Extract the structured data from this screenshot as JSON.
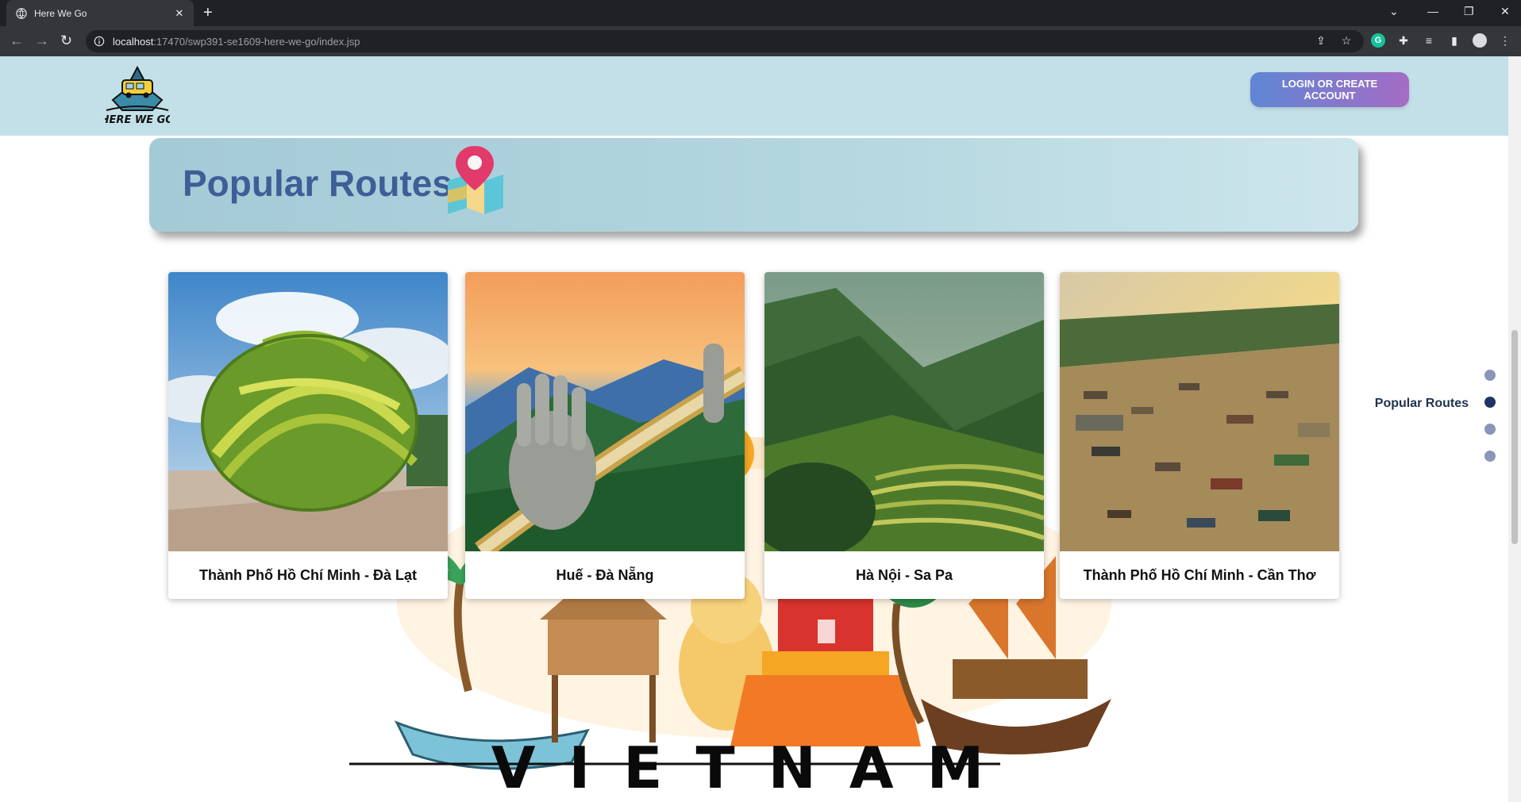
{
  "browser": {
    "tab_title": "Here We Go",
    "tab_close": "✕",
    "new_tab": "+",
    "url_host": "localhost",
    "url_path": ":17470/swp391-se1609-here-we-go/index.jsp"
  },
  "header": {
    "logo_text": "HERE WE GO",
    "login_label": "LOGIN OR CREATE ACCOUNT"
  },
  "hero": {
    "title": "Popular Routes"
  },
  "routes": [
    {
      "name": "Thành Phố Hồ Chí Minh - Đà Lạt"
    },
    {
      "name": "Huế - Đà Nẵng"
    },
    {
      "name": "Hà Nội - Sa Pa"
    },
    {
      "name": "Thành Phố Hồ Chí Minh - Cần Thơ"
    }
  ],
  "side_nav": {
    "active_label": "Popular Routes",
    "active_color": "#1f3466",
    "inactive_color": "#8a96b8"
  },
  "illustration": {
    "word": "VIETNAM"
  },
  "colors": {
    "header_bg": "#c3e0e8",
    "hero_title": "#3e5e98",
    "login_gradient_start": "#5f86d4",
    "login_gradient_end": "#a56cc4"
  }
}
